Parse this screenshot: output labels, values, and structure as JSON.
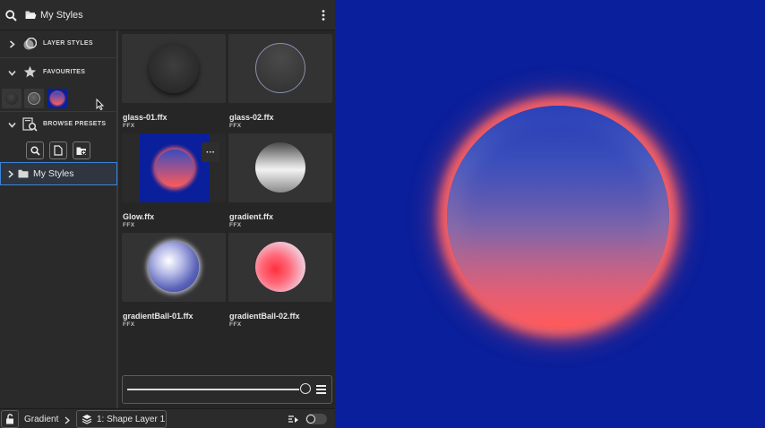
{
  "header": {
    "title": "My Styles",
    "search_icon": "search-icon",
    "folder_icon": "folder-open-icon",
    "menu_icon": "more-vertical-icon"
  },
  "sidebar": {
    "layer_styles": "LAYER STYLES",
    "favourites": "FAVOURITES",
    "browse_presets": "BROWSE PRESETS",
    "tree_item": "My Styles"
  },
  "presets": [
    {
      "name": "glass-01.ffx",
      "type": "FFX"
    },
    {
      "name": "glass-02.ffx",
      "type": "FFX"
    },
    {
      "name": "Glow.ffx",
      "type": "FFX"
    },
    {
      "name": "gradient.ffx",
      "type": "FFX"
    },
    {
      "name": "gradientBall-01.ffx",
      "type": "FFX"
    },
    {
      "name": "gradientBall-02.ffx",
      "type": "FFX"
    }
  ],
  "more_label": "···",
  "footer": {
    "effect": "Gradient",
    "layer": "1: Shape Layer 1"
  },
  "colors": {
    "canvas_bg": "#0a1f9c",
    "glow": "#ff5a5a",
    "selection": "#3d84d6"
  }
}
